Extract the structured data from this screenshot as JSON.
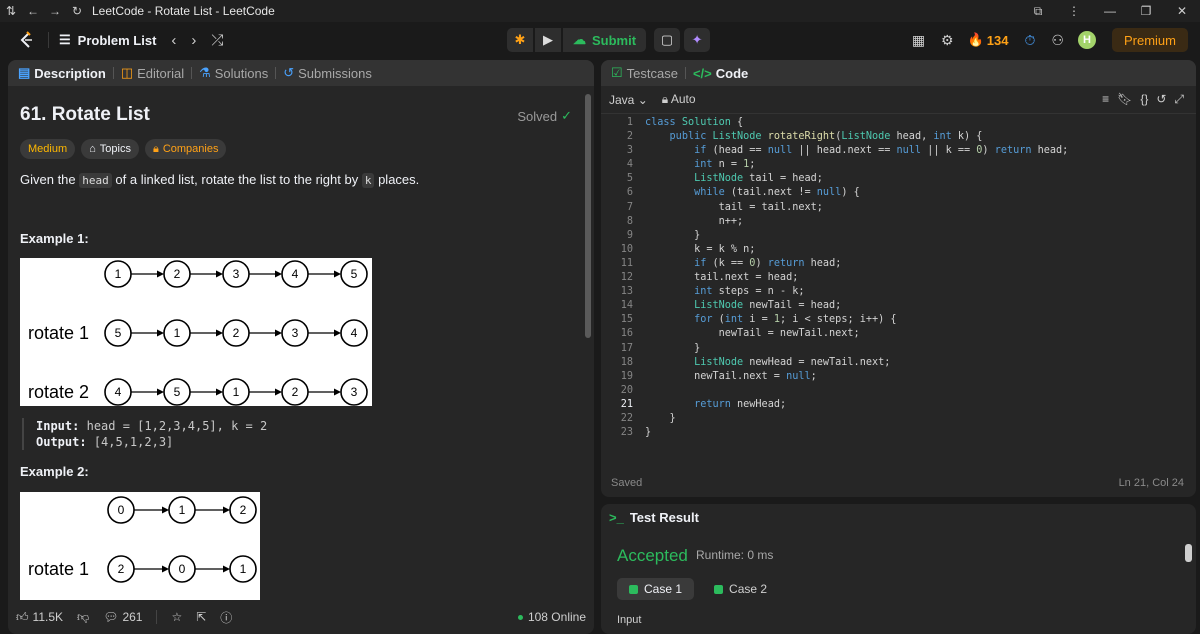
{
  "window": {
    "title": "LeetCode - Rotate List - LeetCode"
  },
  "nav": {
    "problem_list": "Problem List",
    "submit_label": "Submit",
    "streak": "134",
    "avatar_letter": "H",
    "premium_label": "Premium"
  },
  "left_tabs": [
    "Description",
    "Editorial",
    "Solutions",
    "Submissions"
  ],
  "problem": {
    "title": "61. Rotate List",
    "status": "Solved",
    "difficulty": "Medium",
    "topics_label": "Topics",
    "companies_label": "Companies",
    "text_before": "Given the",
    "code_head": "head",
    "text_middle": "of a linked list, rotate the list to the right by",
    "code_k": "k",
    "text_after": "places.",
    "example1_heading": "Example 1:",
    "example1_input_label": "Input:",
    "example1_input": "head = [1,2,3,4,5], k = 2",
    "example1_output_label": "Output:",
    "example1_output": "[4,5,1,2,3]",
    "example2_heading": "Example 2:"
  },
  "diagram1": {
    "rows": [
      {
        "label": "",
        "nodes": [
          "1",
          "2",
          "3",
          "4",
          "5"
        ]
      },
      {
        "label": "rotate 1",
        "nodes": [
          "5",
          "1",
          "2",
          "3",
          "4"
        ]
      },
      {
        "label": "rotate 2",
        "nodes": [
          "4",
          "5",
          "1",
          "2",
          "3"
        ]
      }
    ]
  },
  "diagram2": {
    "rows": [
      {
        "label": "",
        "nodes": [
          "0",
          "1",
          "2"
        ]
      },
      {
        "label": "rotate 1",
        "nodes": [
          "2",
          "0",
          "1"
        ]
      }
    ]
  },
  "footer": {
    "likes": "11.5K",
    "comments": "261",
    "online": "108 Online"
  },
  "code": {
    "tabs": [
      "Testcase",
      "Code"
    ],
    "language": "Java",
    "mode": "Auto",
    "current_line": 21,
    "status": "Saved",
    "cursor": "Ln 21, Col 24",
    "lines": [
      "class Solution {",
      "    public ListNode rotateRight(ListNode head, int k) {",
      "        if (head == null || head.next == null || k == 0) return head;",
      "        int n = 1;",
      "        ListNode tail = head;",
      "        while (tail.next != null) {",
      "            tail = tail.next;",
      "            n++;",
      "        }",
      "        k = k % n;",
      "        if (k == 0) return head;",
      "        tail.next = head;",
      "        int steps = n - k;",
      "        ListNode newTail = head;",
      "        for (int i = 1; i < steps; i++) {",
      "            newTail = newTail.next;",
      "        }",
      "        ListNode newHead = newTail.next;",
      "        newTail.next = null;",
      "",
      "        return newHead;",
      "    }",
      "}"
    ]
  },
  "result": {
    "heading": "Test Result",
    "verdict": "Accepted",
    "runtime": "Runtime: 0 ms",
    "cases": [
      "Case 1",
      "Case 2"
    ],
    "input_label": "Input"
  },
  "colors": {
    "accent": "#ffa116",
    "success": "#2cbb5d",
    "medium": "#ffb800"
  }
}
